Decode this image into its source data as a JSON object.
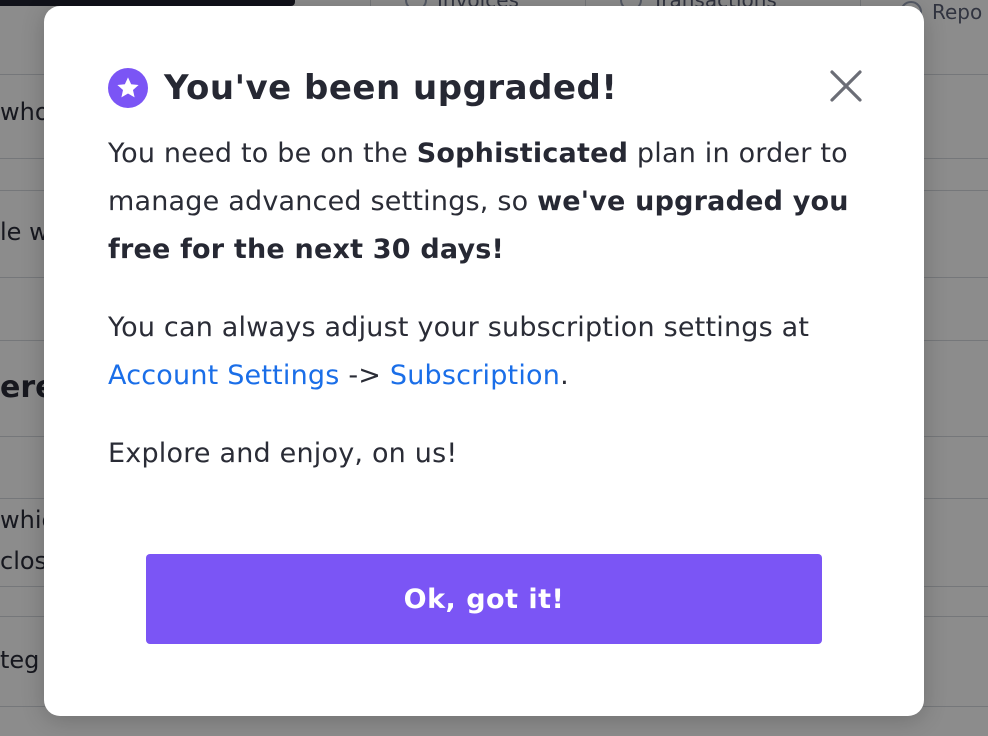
{
  "background": {
    "nav_items": [
      "Invoices",
      "Transactions",
      "Repo"
    ],
    "fragments": [
      "who",
      "le w",
      "ere",
      "whic",
      "clos",
      "teg"
    ]
  },
  "modal": {
    "icon": "star-icon",
    "title": "You've been upgraded!",
    "close_icon": "close-icon",
    "para1": {
      "t1": "You need to be on the ",
      "b1": "Sophisticated",
      "t2": " plan in order to manage advanced settings, so ",
      "b2": "we've upgraded you free for the next 30 days!"
    },
    "para2": {
      "t1": "You can always adjust your subscription settings at ",
      "link1": "Account Settings",
      "sep": " -> ",
      "link2": "Subscription",
      "t2": "."
    },
    "para3": "Explore and enjoy, on us!",
    "button_label": "Ok, got it!"
  },
  "colors": {
    "accent": "#7b55f5",
    "link": "#1a6ee8",
    "text": "#2a2c36",
    "overlay": "rgba(0,0,0,0.45)"
  }
}
